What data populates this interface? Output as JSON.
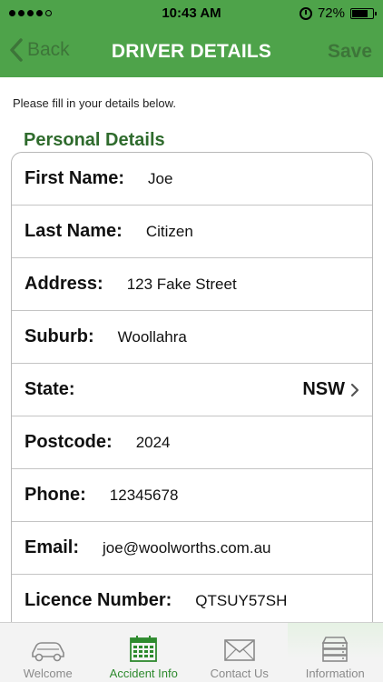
{
  "status": {
    "time": "10:43 AM",
    "battery": "72%",
    "battery_level": 0.72,
    "signal_bars_filled": 4,
    "signal_bars_total": 5
  },
  "nav": {
    "back_label": "Back",
    "title": "DRIVER DETAILS",
    "save_label": "Save"
  },
  "intro_text": "Please fill in your details below.",
  "section_title": "Personal Details",
  "fields": {
    "first_name": {
      "label": "First Name:",
      "value": "Joe"
    },
    "last_name": {
      "label": "Last Name:",
      "value": "Citizen"
    },
    "address": {
      "label": "Address:",
      "value": "123 Fake Street"
    },
    "suburb": {
      "label": "Suburb:",
      "value": "Woollahra"
    },
    "state": {
      "label": "State:",
      "value": "NSW"
    },
    "postcode": {
      "label": "Postcode:",
      "value": "2024"
    },
    "phone": {
      "label": "Phone:",
      "value": "12345678"
    },
    "email": {
      "label": "Email:",
      "value": "joe@woolworths.com.au"
    },
    "licence_number": {
      "label": "Licence Number:",
      "value": "QTSUY57SH"
    }
  },
  "tabs": {
    "welcome": {
      "label": "Welcome",
      "icon": "car-icon"
    },
    "accident_info": {
      "label": "Accident Info",
      "icon": "calendar-icon"
    },
    "contact_us": {
      "label": "Contact Us",
      "icon": "envelope-icon"
    },
    "information": {
      "label": "Information",
      "icon": "server-icon"
    }
  },
  "colors": {
    "brand_green": "#4ea34a",
    "section_green": "#2f6b2d",
    "active_tab": "#2e8a2e"
  }
}
